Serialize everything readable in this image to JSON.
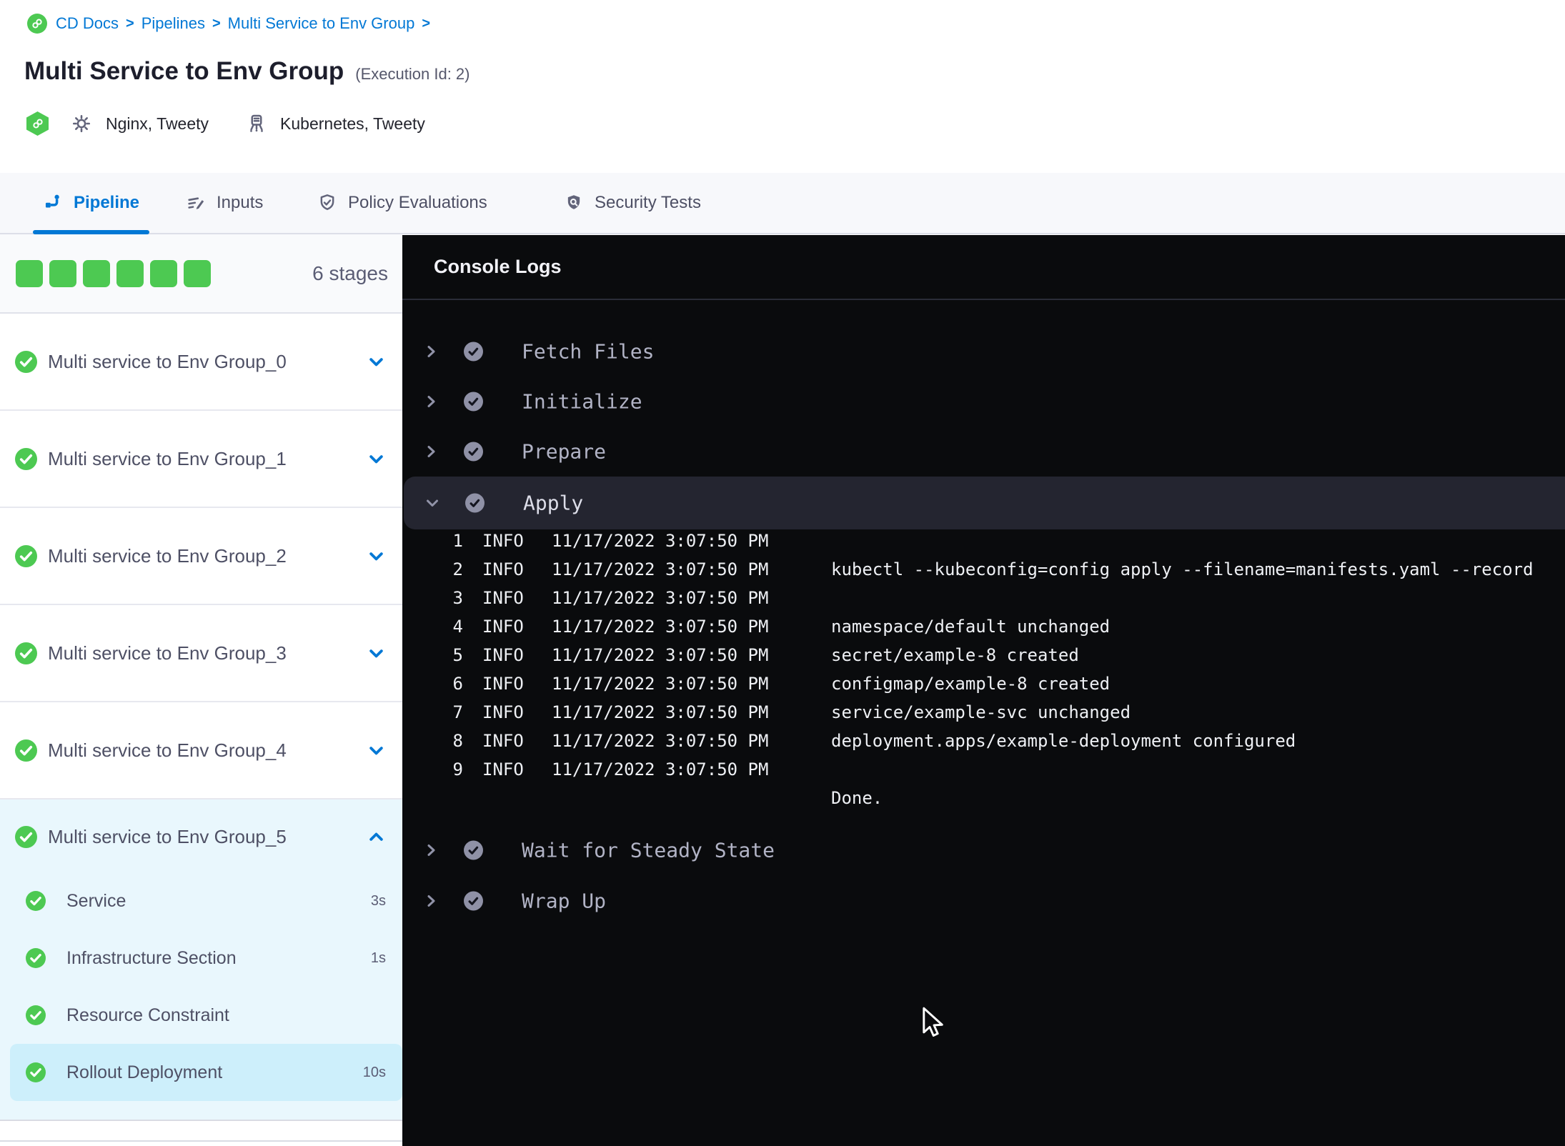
{
  "colors": {
    "accent_blue": "#0278d5",
    "success_green": "#4dc952",
    "console_bg": "#0a0b0d",
    "console_highlight": "#242530",
    "expanded_bg": "#e9f7fd",
    "selected_step_bg": "#cdeffb"
  },
  "breadcrumb": {
    "items": [
      "CD Docs",
      "Pipelines",
      "Multi Service to Env Group"
    ],
    "separator": ">"
  },
  "header": {
    "title": "Multi Service to Env Group",
    "execution_id": "(Execution Id: 2)",
    "services": "Nginx, Tweety",
    "environments": "Kubernetes, Tweety"
  },
  "tabs": [
    {
      "label": "Pipeline",
      "active": true
    },
    {
      "label": "Inputs",
      "active": false
    },
    {
      "label": "Policy Evaluations",
      "active": false
    },
    {
      "label": "Security Tests",
      "active": false
    }
  ],
  "sidebar": {
    "stage_count": "6 stages",
    "square_count": 6,
    "stages": [
      {
        "label": "Multi service to Env Group_0"
      },
      {
        "label": "Multi service to Env Group_1"
      },
      {
        "label": "Multi service to Env Group_2"
      },
      {
        "label": "Multi service to Env Group_3"
      },
      {
        "label": "Multi service to Env Group_4"
      }
    ],
    "expanded_stage": {
      "label": "Multi service to Env Group_5",
      "steps": [
        {
          "label": "Service",
          "duration": "3s",
          "selected": false
        },
        {
          "label": "Infrastructure Section",
          "duration": "1s",
          "selected": false
        },
        {
          "label": "Resource Constraint",
          "duration": "",
          "selected": false
        },
        {
          "label": "Rollout Deployment",
          "duration": "10s",
          "selected": true
        }
      ]
    }
  },
  "console": {
    "title": "Console Logs",
    "steps_before": [
      {
        "label": "Fetch Files"
      },
      {
        "label": "Initialize"
      },
      {
        "label": "Prepare"
      }
    ],
    "expanded_step": {
      "label": "Apply"
    },
    "steps_after": [
      {
        "label": "Wait for Steady State"
      },
      {
        "label": "Wrap Up"
      }
    ],
    "logs": [
      {
        "n": "1",
        "level": "INFO",
        "time": "11/17/2022 3:07:50 PM",
        "msg": ""
      },
      {
        "n": "2",
        "level": "INFO",
        "time": "11/17/2022 3:07:50 PM",
        "msg": "kubectl --kubeconfig=config apply --filename=manifests.yaml --record"
      },
      {
        "n": "3",
        "level": "INFO",
        "time": "11/17/2022 3:07:50 PM",
        "msg": ""
      },
      {
        "n": "4",
        "level": "INFO",
        "time": "11/17/2022 3:07:50 PM",
        "msg": "namespace/default unchanged"
      },
      {
        "n": "5",
        "level": "INFO",
        "time": "11/17/2022 3:07:50 PM",
        "msg": "secret/example-8 created"
      },
      {
        "n": "6",
        "level": "INFO",
        "time": "11/17/2022 3:07:50 PM",
        "msg": "configmap/example-8 created"
      },
      {
        "n": "7",
        "level": "INFO",
        "time": "11/17/2022 3:07:50 PM",
        "msg": "service/example-svc unchanged"
      },
      {
        "n": "8",
        "level": "INFO",
        "time": "11/17/2022 3:07:50 PM",
        "msg": "deployment.apps/example-deployment configured"
      },
      {
        "n": "9",
        "level": "INFO",
        "time": "11/17/2022 3:07:50 PM",
        "msg": ""
      },
      {
        "n": "",
        "level": "",
        "time": "",
        "msg": "Done."
      }
    ]
  }
}
